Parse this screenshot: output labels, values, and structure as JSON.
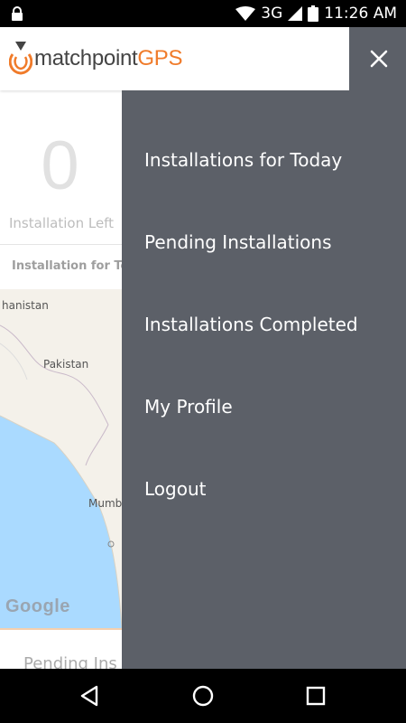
{
  "status_bar": {
    "network": "3G",
    "time": "11:26 AM"
  },
  "header": {
    "brand_main": "matchpoint",
    "brand_accent": "GPS"
  },
  "stats": {
    "count": "0",
    "count_label": "Installation Left"
  },
  "tab": {
    "label": "Installation for To"
  },
  "map": {
    "labels": {
      "afghanistan": "hanistan",
      "pakistan": "Pakistan",
      "mumbai": "Mumb"
    },
    "attribution": "Google"
  },
  "pending": {
    "title": "Pending Ins"
  },
  "drawer": {
    "items": [
      {
        "label": "Installations for Today"
      },
      {
        "label": "Pending Installations"
      },
      {
        "label": "Installations Completed"
      },
      {
        "label": "My Profile"
      },
      {
        "label": "Logout"
      }
    ]
  },
  "colors": {
    "drawer_bg": "#5c6068",
    "brand_orange": "#f07b2a"
  }
}
